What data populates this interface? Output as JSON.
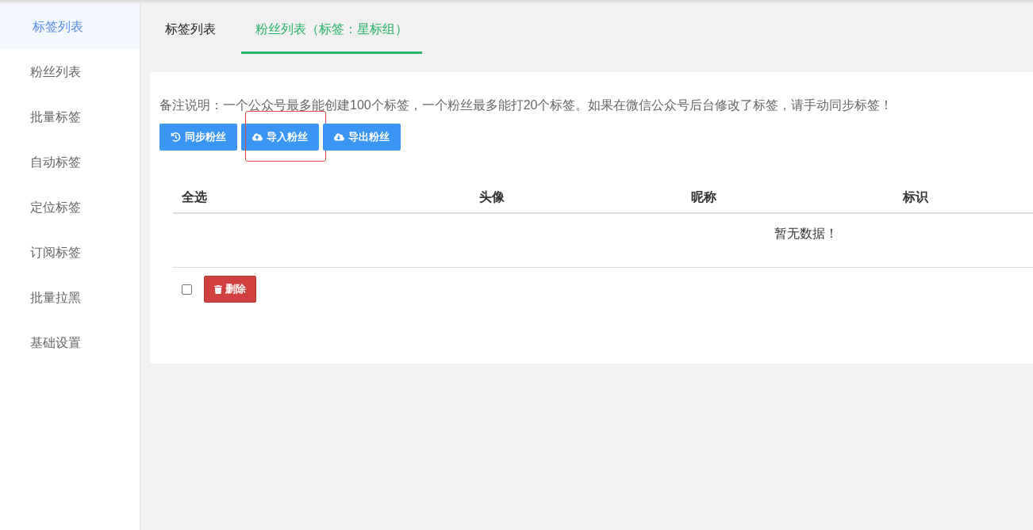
{
  "sidebar": {
    "items": [
      {
        "label": "标签列表",
        "selected": true
      },
      {
        "label": "粉丝列表",
        "selected": false
      },
      {
        "label": "批量标签",
        "selected": false
      },
      {
        "label": "自动标签",
        "selected": false
      },
      {
        "label": "定位标签",
        "selected": false
      },
      {
        "label": "订阅标签",
        "selected": false
      },
      {
        "label": "批量拉黑",
        "selected": false
      },
      {
        "label": "基础设置",
        "selected": false
      }
    ]
  },
  "tabs": [
    {
      "label": "标签列表",
      "selected": false
    },
    {
      "label": "粉丝列表（标签：星标组）",
      "selected": true
    }
  ],
  "notice": "备注说明：一个公众号最多能创建100个标签，一个粉丝最多能打20个标签。如果在微信公众号后台修改了标签，请手动同步标签！",
  "toolbar": {
    "buttons": [
      {
        "label": "同步粉丝",
        "kind": "sync",
        "highlighted": false
      },
      {
        "label": "导入粉丝",
        "kind": "import",
        "highlighted": true
      },
      {
        "label": "导出粉丝",
        "kind": "export",
        "highlighted": false
      }
    ]
  },
  "table": {
    "columns": [
      "全选",
      "头像",
      "昵称",
      "标识"
    ],
    "empty_text": "暂无数据！"
  },
  "footer": {
    "select_all_checked": false,
    "delete_button": {
      "label": "删除"
    }
  }
}
